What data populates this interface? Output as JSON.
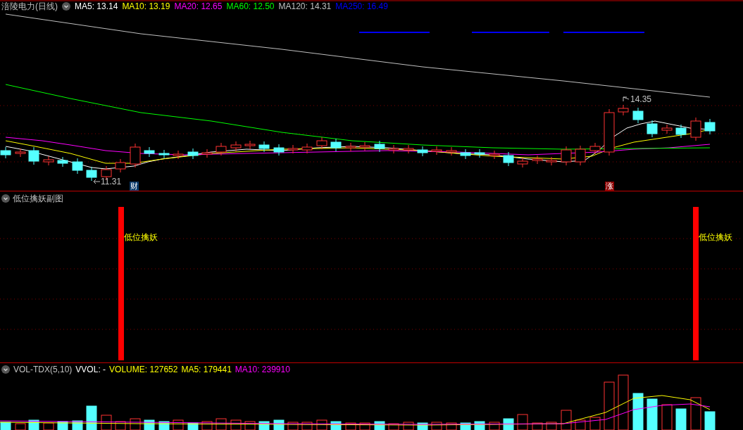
{
  "main_chart": {
    "title": "涪陵电力(日线)",
    "indicators": [
      {
        "label": "MA5: 13.14",
        "color": "#ffffff"
      },
      {
        "label": "MA10: 13.19",
        "color": "#ffff00"
      },
      {
        "label": "MA20: 12.65",
        "color": "#ff00ff"
      },
      {
        "label": "MA60: 12.50",
        "color": "#00ff00"
      },
      {
        "label": "MA120: 14.31",
        "color": "#c0c0c0"
      },
      {
        "label": "MA250: 16.49",
        "color": "#0000ff"
      }
    ],
    "low_label": "11.31",
    "high_label": "14.35",
    "badges": [
      {
        "text": "财",
        "color": "#0a3a6a"
      },
      {
        "text": "涨",
        "color": "#8b0000"
      }
    ]
  },
  "sub_chart": {
    "title": "低位擒妖副图",
    "signals": [
      "低位擒妖",
      "低位擒妖"
    ]
  },
  "volume_chart": {
    "indicators": [
      {
        "label": "VOL-TDX(5,10)",
        "color": "#c0c0c0"
      },
      {
        "label": "VVOL: -",
        "color": "#ffffff"
      },
      {
        "label": "VOLUME: 127652",
        "color": "#ffff00"
      },
      {
        "label": "MA5: 179441",
        "color": "#ffff00"
      },
      {
        "label": "MA10: 239910",
        "color": "#ff00ff"
      }
    ]
  }
}
